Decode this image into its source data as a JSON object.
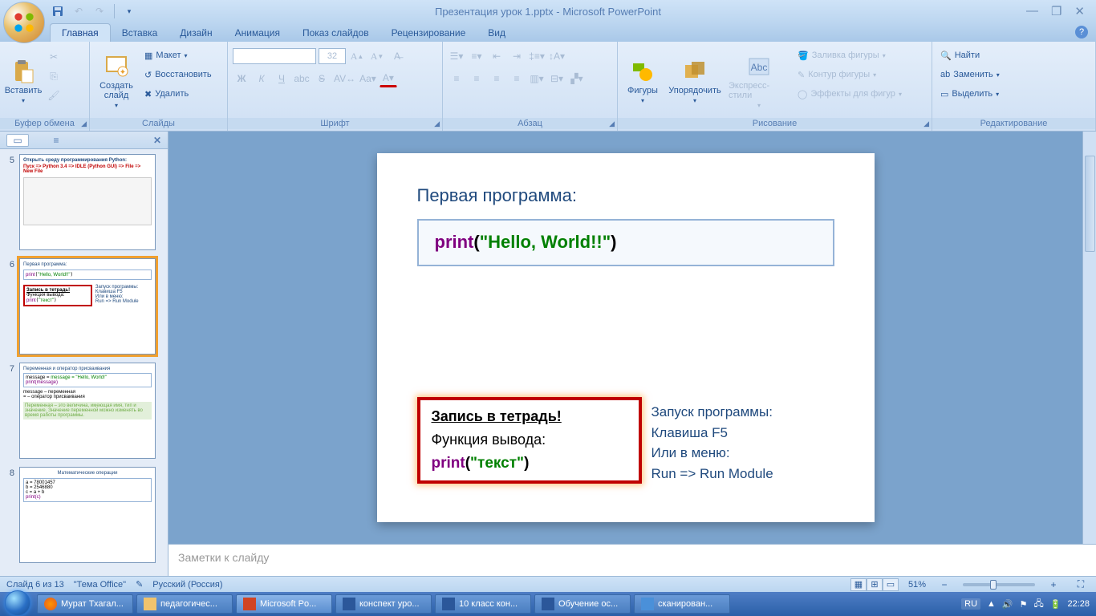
{
  "title": "Презентация урок 1.pptx - Microsoft PowerPoint",
  "tabs": [
    "Главная",
    "Вставка",
    "Дизайн",
    "Анимация",
    "Показ слайдов",
    "Рецензирование",
    "Вид"
  ],
  "ribbon": {
    "clipboard": {
      "label": "Буфер обмена",
      "paste": "Вставить"
    },
    "slides": {
      "label": "Слайды",
      "new": "Создать\nслайд",
      "layout": "Макет",
      "reset": "Восстановить",
      "delete": "Удалить"
    },
    "font": {
      "label": "Шрифт",
      "size": "32"
    },
    "paragraph": {
      "label": "Абзац"
    },
    "drawing": {
      "label": "Рисование",
      "shapes": "Фигуры",
      "arrange": "Упорядочить",
      "quickstyles": "Экспресс-стили",
      "fill": "Заливка фигуры",
      "outline": "Контур фигуры",
      "effects": "Эффекты для фигур"
    },
    "editing": {
      "label": "Редактирование",
      "find": "Найти",
      "replace": "Заменить",
      "select": "Выделить"
    }
  },
  "thumbs": {
    "n5": "5",
    "n6": "6",
    "n7": "7",
    "n8": "8",
    "t5_title": "Открыть среду программирования Python:",
    "t5_line": "Пуск  =>  Python 3.4  =>  IDLE (Python GUI)  =>  File  =>  New File",
    "t6_title": "Первая программа:",
    "t7_title": "Переменная и оператор присваивания",
    "t7_l1": "message = \"Hello, World!\"",
    "t7_l2": "print(message)",
    "t7_l3": "message – переменная",
    "t7_l4": "= – оператор присваивания",
    "t7_note": "Переменная – это величина, имеющая имя, тип и значение. Значение переменной можно изменять во время работы программы.",
    "t8_title": "Математические операции",
    "t8_l1": "a = 78001457",
    "t8_l2": "b = 2546880",
    "t8_l3": "c = a + b",
    "t8_l4": "print(c)"
  },
  "slide": {
    "title": "Первая программа:",
    "code1_print": "print",
    "code1_open": "(",
    "code1_str": "\"Hello, World!!\"",
    "code1_close": ")",
    "box2_title": "Запись в тетрадь!",
    "box2_sub": "Функция вывода:",
    "box2_print": "print",
    "box2_open": "(",
    "box2_str": "\"текст\"",
    "box2_close": ")",
    "right_l1": "Запуск программы:",
    "right_l2": "Клавиша F5",
    "right_l3": "Или в меню:",
    "right_l4": "Run   =>  Run Module"
  },
  "notes_placeholder": "Заметки к слайду",
  "status": {
    "slide": "Слайд 6 из 13",
    "theme": "\"Тема Office\"",
    "lang": "Русский (Россия)",
    "zoom": "51%"
  },
  "taskbar": {
    "items": [
      "Мурат Тхагал...",
      "педагогичес...",
      "Microsoft Po...",
      "конспект уро...",
      "10 класс кон...",
      "Обучение ос...",
      "сканирован..."
    ],
    "lang": "RU",
    "time": "22:28"
  }
}
